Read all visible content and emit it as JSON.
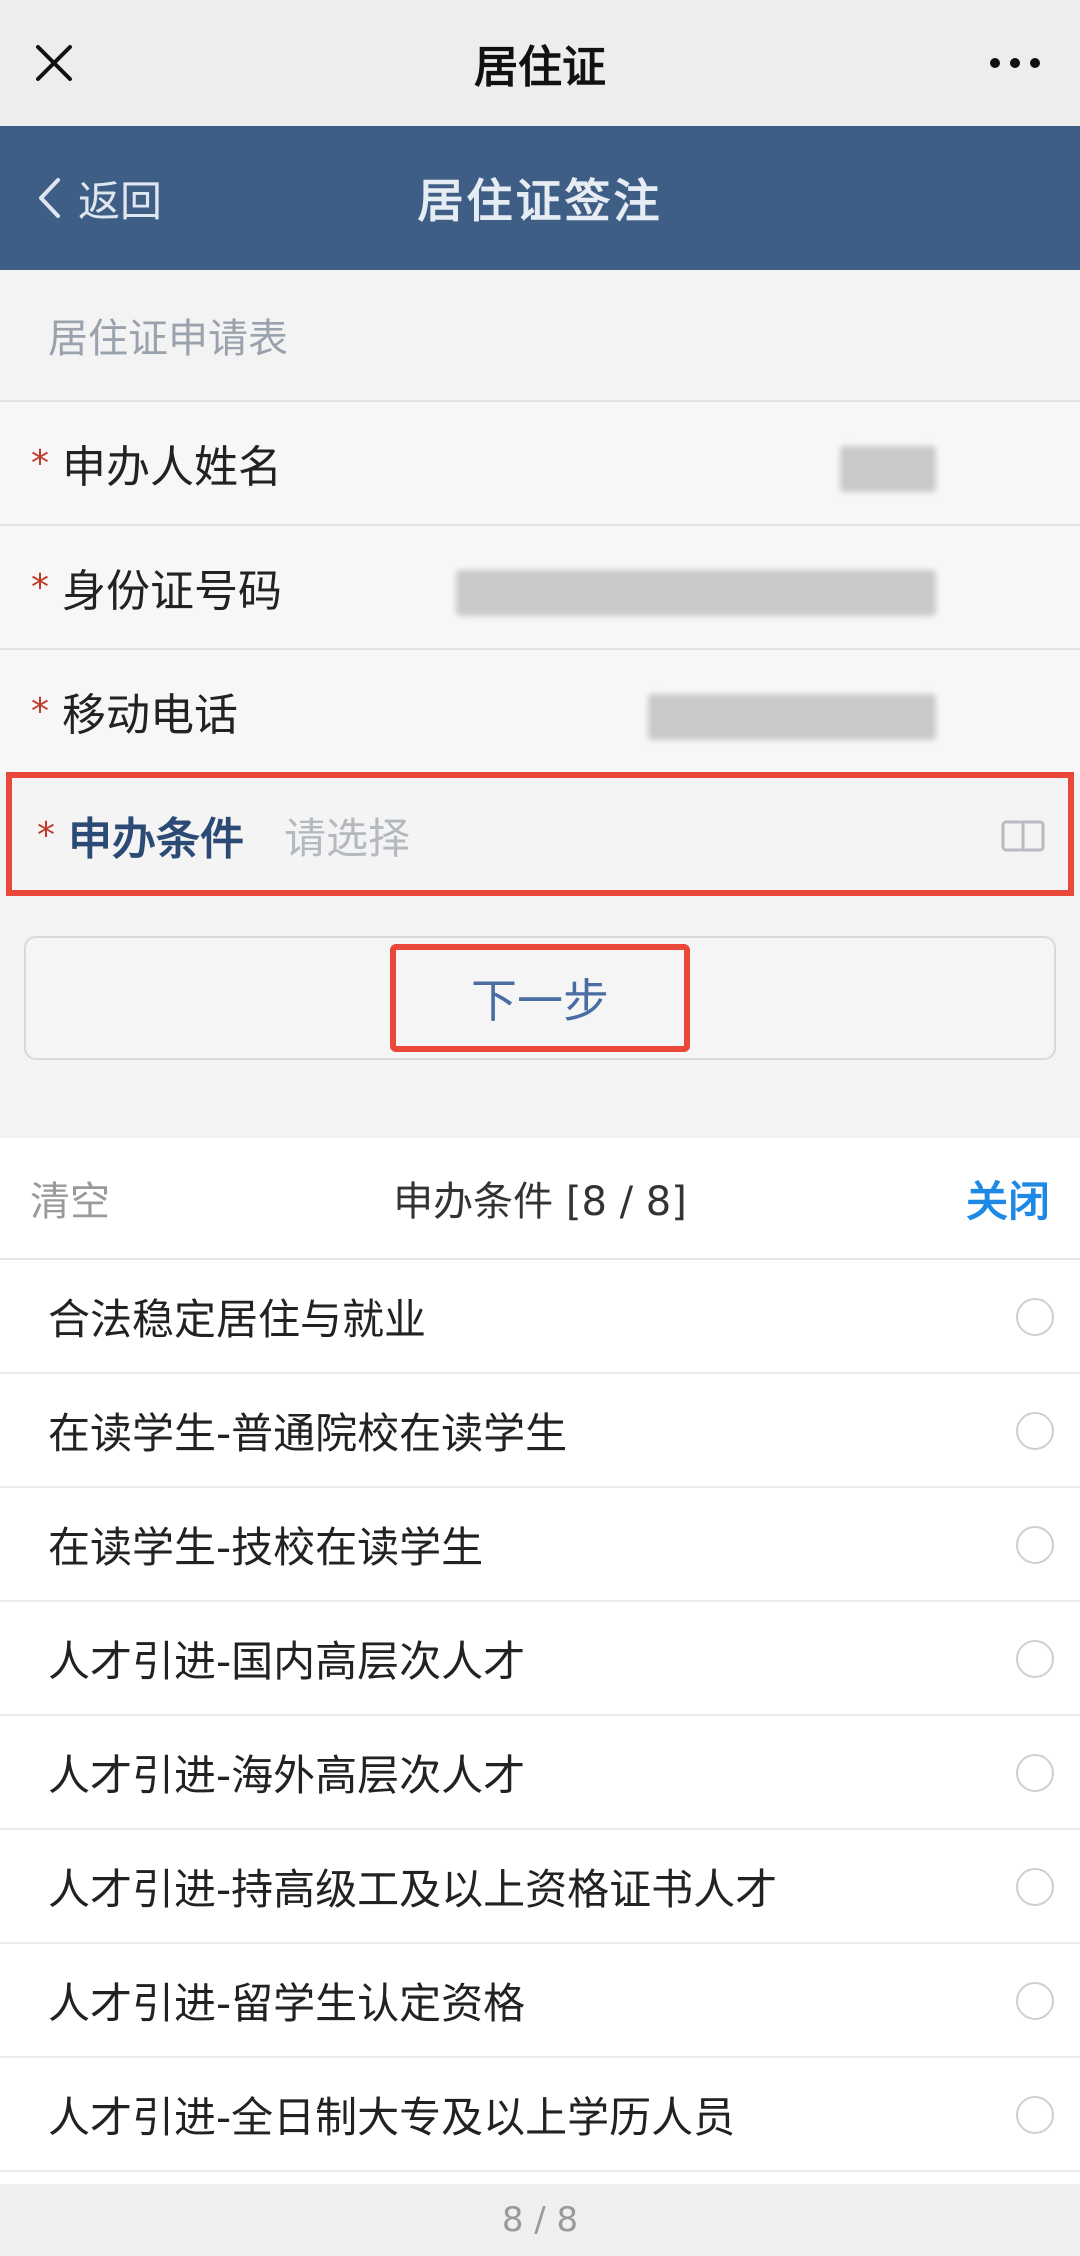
{
  "topbar": {
    "title": "居住证"
  },
  "header": {
    "back_label": "返回",
    "title": "居住证签注"
  },
  "form": {
    "title": "居住证申请表",
    "fields": [
      {
        "label": "申办人姓名"
      },
      {
        "label": "身份证号码"
      },
      {
        "label": "移动电话"
      },
      {
        "label": "申办条件",
        "placeholder": "请选择"
      }
    ],
    "next_label": "下一步"
  },
  "picker": {
    "clear_label": "清空",
    "title": "申办条件 [8 / 8]",
    "close_label": "关闭",
    "options": [
      "合法稳定居住与就业",
      "在读学生-普通院校在读学生",
      "在读学生-技校在读学生",
      "人才引进-国内高层次人才",
      "人才引进-海外高层次人才",
      "人才引进-持高级工及以上资格证书人才",
      "人才引进-留学生认定资格",
      "人才引进-全日制大专及以上学历人员"
    ],
    "footer": "8 / 8"
  },
  "colors": {
    "header_bg": "#3f5e86",
    "highlight": "#e8473a",
    "accent": "#1e88e5",
    "required_star": "#c0392b"
  },
  "icons": [
    "close-icon",
    "more-icon",
    "chevron-left-icon",
    "book-icon",
    "radio-icon"
  ]
}
